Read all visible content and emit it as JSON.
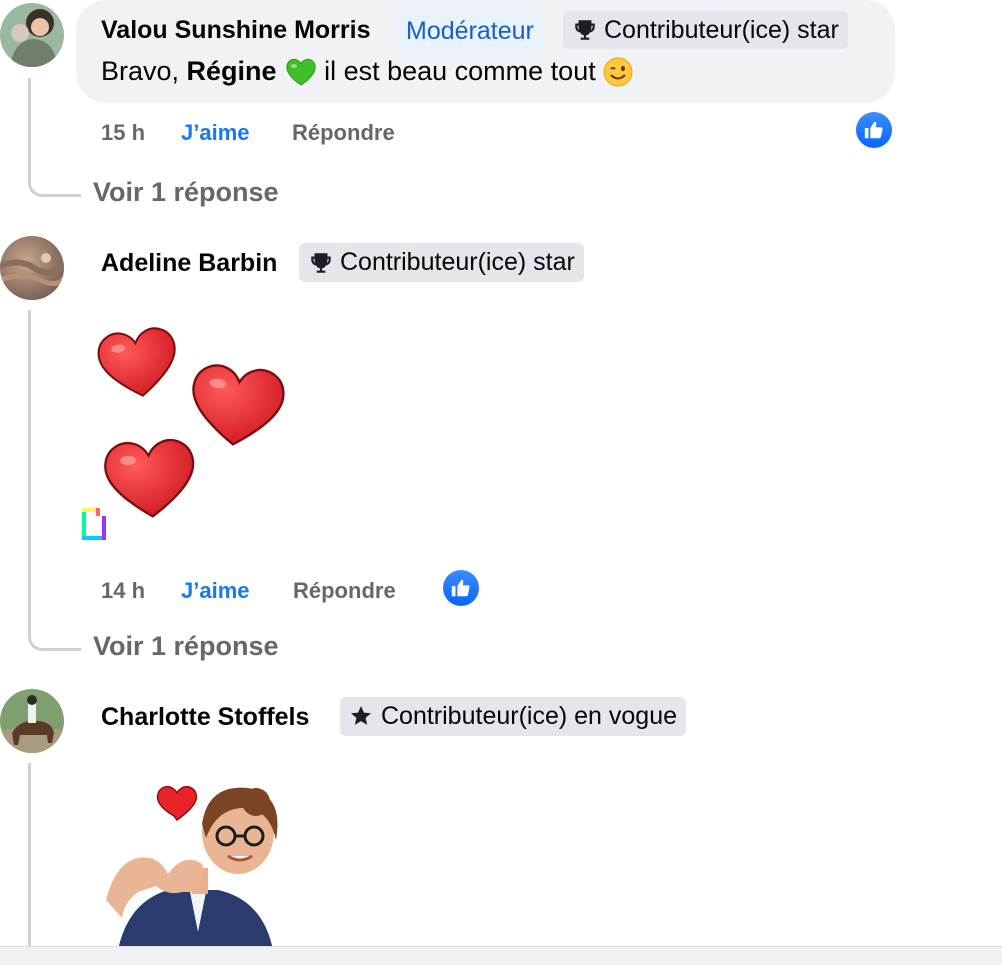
{
  "comments": [
    {
      "author": "Valou Sunshine Morris",
      "badges": [
        "Modérateur",
        "Contributeur(ice) star"
      ],
      "text_prefix": "Bravo, ",
      "text_mention": "Régine",
      "text_suffix": " il est beau comme tout ",
      "time": "15 h",
      "like_label": "J’aime",
      "reply_label": "Répondre",
      "view_replies": "Voir 1 réponse"
    },
    {
      "author": "Adeline Barbin",
      "badges": [
        "Contributeur(ice) star"
      ],
      "time": "14 h",
      "like_label": "J’aime",
      "reply_label": "Répondre",
      "view_replies": "Voir 1 réponse"
    },
    {
      "author": "Charlotte Stoffels",
      "badges": [
        "Contributeur(ice) en vogue"
      ]
    }
  ],
  "icons": {
    "trophy": "trophy-icon",
    "star": "star-icon",
    "like": "thumbs-up-icon",
    "green_heart": "green-heart-emoji",
    "wink": "wink-emoji"
  },
  "colors": {
    "like_blue": "#1877f2",
    "moderator_text": "#1a5dc9",
    "heart_red": "#e8232b"
  }
}
